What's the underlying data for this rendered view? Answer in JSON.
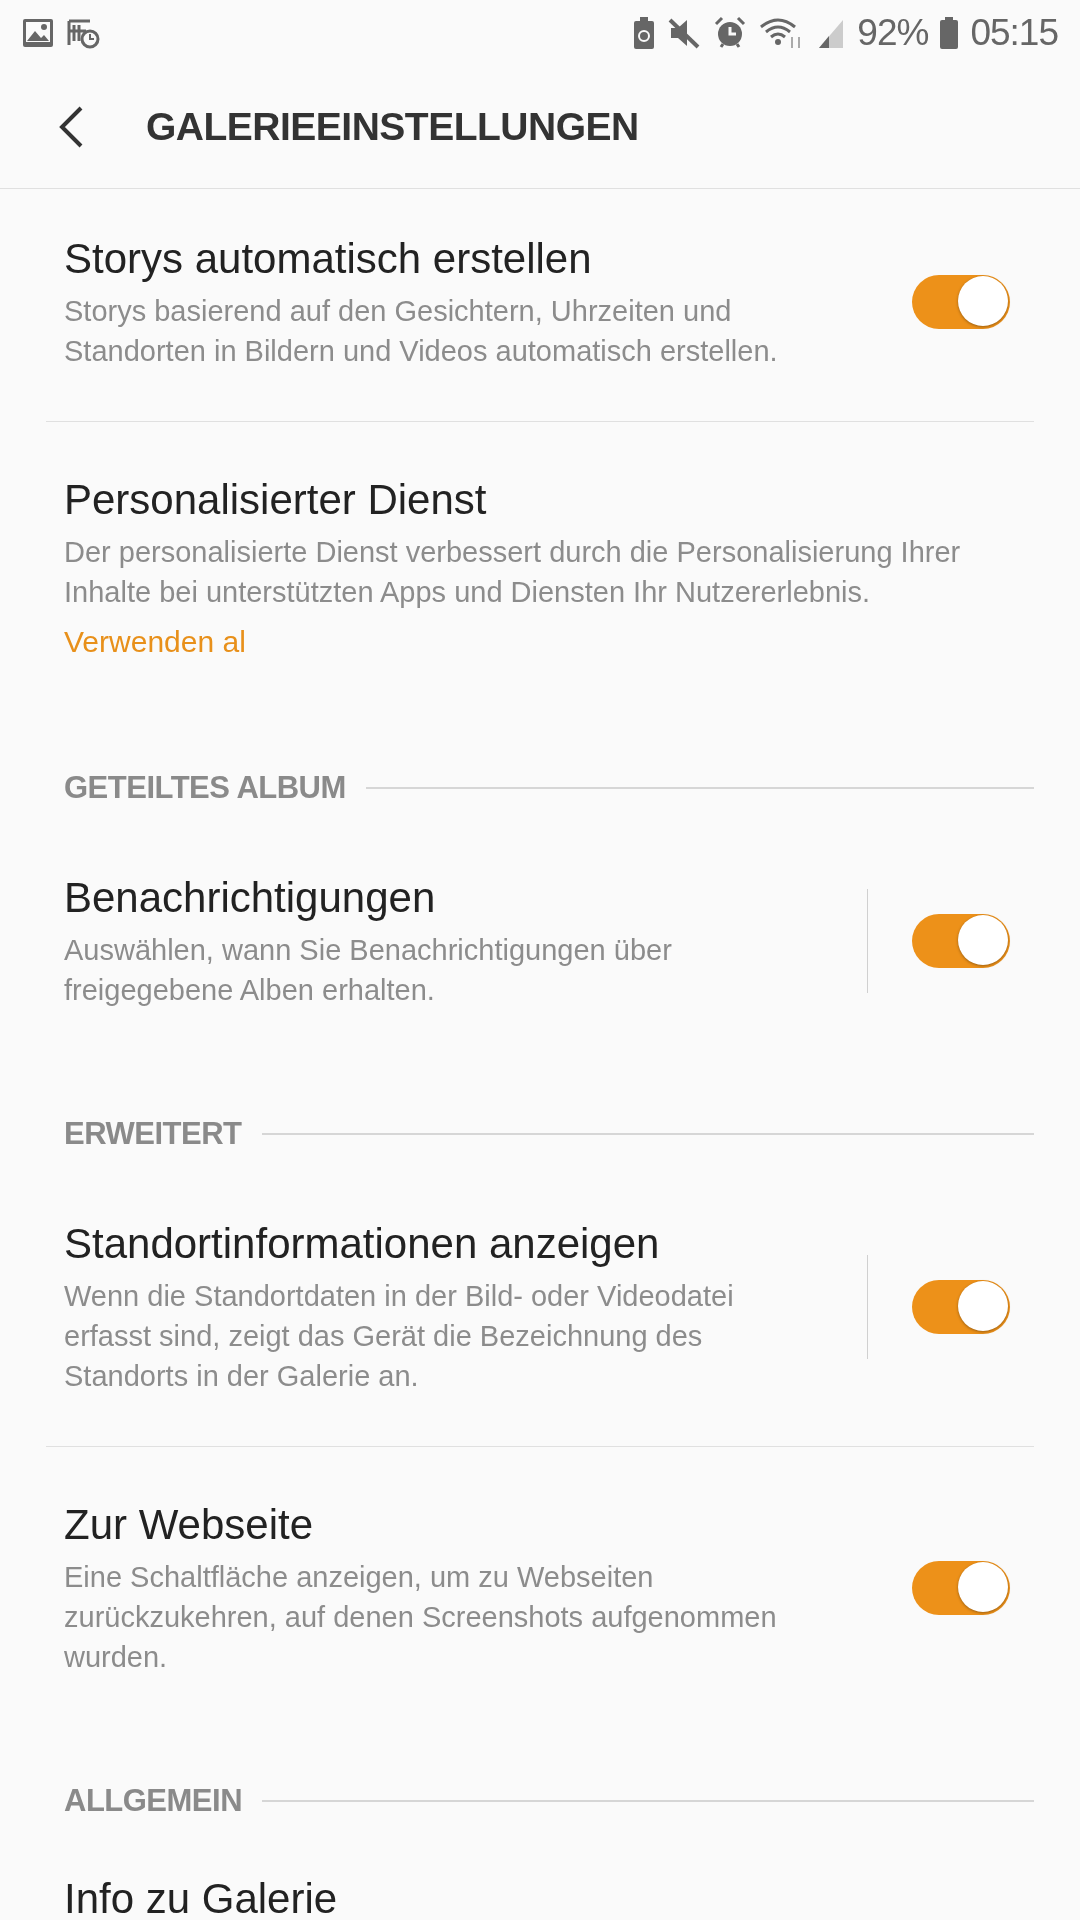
{
  "status_bar": {
    "battery": "92%",
    "time": "05:15"
  },
  "header": {
    "title": "GALERIEEINSTELLUNGEN"
  },
  "sections": [
    {
      "items": [
        {
          "kind": "toggle",
          "title": "Storys automatisch erstellen",
          "description": "Storys basierend auf den Gesichtern, Uhrzeiten und Standorten in Bildern und Videos automatisch erstellen.",
          "on": true,
          "split": false
        },
        {
          "kind": "link",
          "title": "Personalisierter Dienst",
          "description": "Der personalisierte Dienst verbessert durch die Personalisierung Ihrer Inhalte bei unterstützten Apps und Diensten Ihr Nutzererlebnis.",
          "link": "Verwenden al"
        }
      ]
    },
    {
      "header": "GETEILTES ALBUM",
      "items": [
        {
          "kind": "toggle",
          "title": "Benachrichtigungen",
          "description": "Auswählen, wann Sie Benachrichtigungen über freigegebene Alben erhalten.",
          "on": true,
          "split": true
        }
      ]
    },
    {
      "header": "ERWEITERT",
      "items": [
        {
          "kind": "toggle",
          "title": "Standortinformationen anzeigen",
          "description": "Wenn die Standortdaten in der Bild- oder Videodatei erfasst sind, zeigt das Gerät die Bezeichnung des Standorts in der Galerie an.",
          "on": true,
          "split": true
        },
        {
          "kind": "toggle",
          "title": "Zur Webseite",
          "description": "Eine Schaltfläche anzeigen, um zu Webseiten zurückzukehren, auf denen Screenshots aufgenommen wurden.",
          "on": true,
          "split": false
        }
      ]
    },
    {
      "header": "ALLGEMEIN",
      "items": [
        {
          "kind": "plain",
          "title": "Info zu Galerie"
        }
      ]
    }
  ]
}
